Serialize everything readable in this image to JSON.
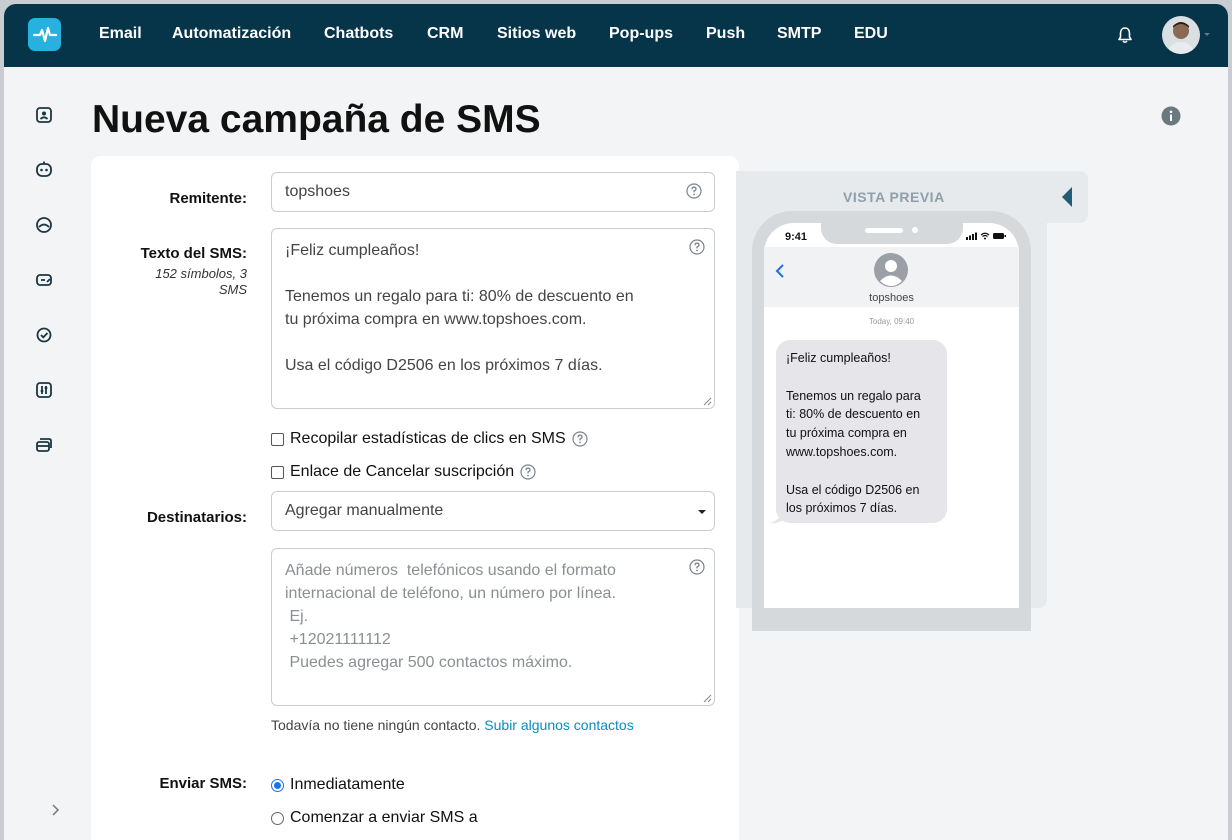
{
  "nav": {
    "items": [
      "Email",
      "Automatización",
      "Chatbots",
      "CRM",
      "Sitios web",
      "Pop-ups",
      "Push",
      "SMTP",
      "EDU"
    ]
  },
  "page": {
    "title": "Nueva campaña de SMS"
  },
  "form": {
    "sender": {
      "label": "Remitente:",
      "value": "topshoes"
    },
    "sms_text": {
      "label": "Texto del SMS:",
      "counter": "152 símbolos, 3 SMS",
      "value": "¡Feliz cumpleaños!\n\nTenemos un regalo para ti: 80% de descuento en\ntu próxima compra en www.topshoes.com.\n\nUsa el código D2506 en los próximos 7 días."
    },
    "checkbox_click_stats": {
      "label": "Recopilar estadísticas de clics en SMS",
      "checked": false
    },
    "checkbox_unsubscribe": {
      "label": "Enlace de Cancelar suscripción",
      "checked": false
    },
    "recipients": {
      "label": "Destinatarios:",
      "selected": "Agregar manualmente",
      "placeholder": "Añade números  telefónicos usando el formato\ninternacional de teléfono, un número por línea.\n Ej.\n +12021111112\n Puedes agregar 500 contactos máximo."
    },
    "contacts_note": {
      "text": "Todavía no tiene ningún contacto. ",
      "link": "Subir algunos contactos"
    },
    "send": {
      "label": "Enviar SMS:",
      "option_now": "Inmediatamente",
      "option_later": "Comenzar a enviar SMS a"
    }
  },
  "preview": {
    "title": "VISTA PREVIA",
    "time": "9:41",
    "contact": "topshoes",
    "date": "Today, 09:40",
    "message": "¡Feliz cumpleaños!\n\nTenemos un regalo para\nti: 80% de descuento en\ntu próxima compra en\nwww.topshoes.com.\n\nUsa el código D2506 en\nlos próximos 7 días."
  },
  "colors": {
    "nav_bg": "#06354a",
    "accent": "#27b1e0",
    "link": "#0b8bc1",
    "radio": "#1a73e8"
  }
}
